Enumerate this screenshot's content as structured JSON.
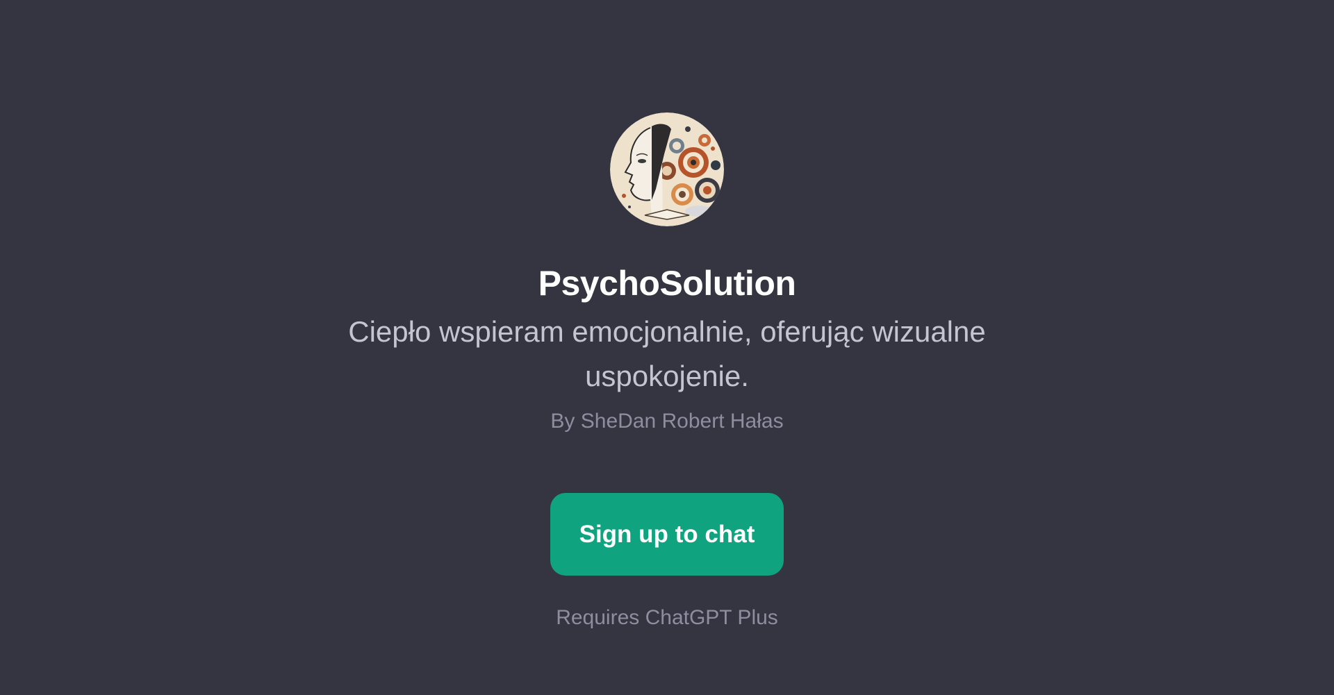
{
  "gpt": {
    "title": "PsychoSolution",
    "description": "Ciepło wspieram emocjonalnie, oferując wizualne uspokojenie.",
    "author": "By SheDan Robert Hałas",
    "avatar_icon": "abstract-mind-portrait-icon"
  },
  "cta": {
    "signup_label": "Sign up to chat",
    "requirement_note": "Requires ChatGPT Plus"
  },
  "colors": {
    "background": "#343541",
    "title": "#ffffff",
    "description": "#c5c5d2",
    "muted": "#8e8ea0",
    "accent": "#10a37f"
  }
}
